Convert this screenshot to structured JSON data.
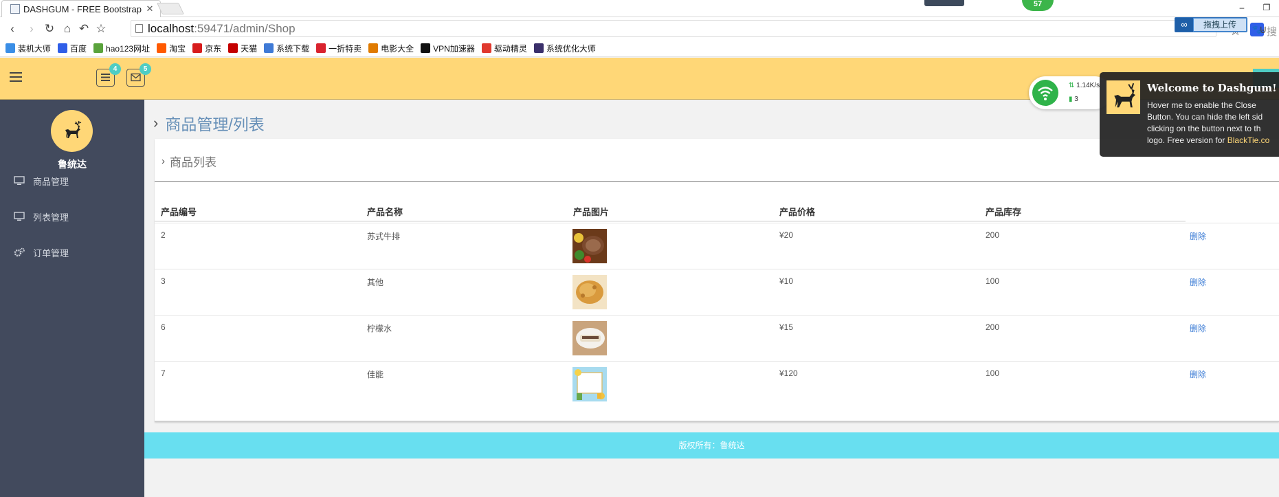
{
  "browser": {
    "tab_title": "DASHGUM - FREE Bootstrap",
    "url_host": "localhost",
    "url_path": ":59471/admin/Shop",
    "extension_badge": "57",
    "search_placeholder": "搜索",
    "upload_label": "拖拽上传",
    "bookmarks": [
      {
        "label": "装机大师",
        "color": "#3a8ee6"
      },
      {
        "label": "百度",
        "color": "#2f5ee8"
      },
      {
        "label": "hao123网址",
        "color": "#5aa33c"
      },
      {
        "label": "淘宝",
        "color": "#ff5a00"
      },
      {
        "label": "京东",
        "color": "#d71c1c"
      },
      {
        "label": "天猫",
        "color": "#c40000"
      },
      {
        "label": "系统下载",
        "color": "#3f7ad6"
      },
      {
        "label": "一折特卖",
        "color": "#d9232e"
      },
      {
        "label": "电影大全",
        "color": "#e07b00"
      },
      {
        "label": "VPN加速器",
        "color": "#111111"
      },
      {
        "label": "驱动精灵",
        "color": "#e0392e"
      },
      {
        "label": "系统优化大师",
        "color": "#3a2f6a"
      }
    ]
  },
  "header": {
    "task_badge": "4",
    "mail_badge": "5"
  },
  "sidebar": {
    "user_name": "鲁统达",
    "items": [
      {
        "label": "商品管理",
        "icon": "monitor-icon"
      },
      {
        "label": "列表管理",
        "icon": "monitor-icon"
      },
      {
        "label": "订单管理",
        "icon": "cogs-icon"
      }
    ]
  },
  "main": {
    "page_title": "商品管理/列表",
    "panel_title": "商品列表",
    "columns": [
      "产品编号",
      "产品名称",
      "产品图片",
      "产品价格",
      "产品库存"
    ],
    "rows": [
      {
        "id": "2",
        "name": "苏式牛排",
        "price": "¥20",
        "stock": "200",
        "action": "删除",
        "image": "steak-image"
      },
      {
        "id": "3",
        "name": "其他",
        "price": "¥10",
        "stock": "100",
        "action": "删除",
        "image": "fried-chicken-image"
      },
      {
        "id": "6",
        "name": "柠檬水",
        "price": "¥15",
        "stock": "200",
        "action": "删除",
        "image": "sliced-dish-image"
      },
      {
        "id": "7",
        "name": "佳能",
        "price": "¥120",
        "stock": "100",
        "action": "删除",
        "image": "cartoon-frame-image"
      }
    ]
  },
  "footer": {
    "copyright": "版权所有：鲁统达"
  },
  "network_widget": {
    "speed": "1.14K/s",
    "connections": "3"
  },
  "notification": {
    "title": "Welcome to Dashgum!",
    "line1": "Hover me to enable the Close",
    "line2": "Button. You can hide the left sid",
    "line3": "clicking on the button next to th",
    "line4_prefix": "logo. Free version for ",
    "line4_link": "BlackTie.co"
  }
}
